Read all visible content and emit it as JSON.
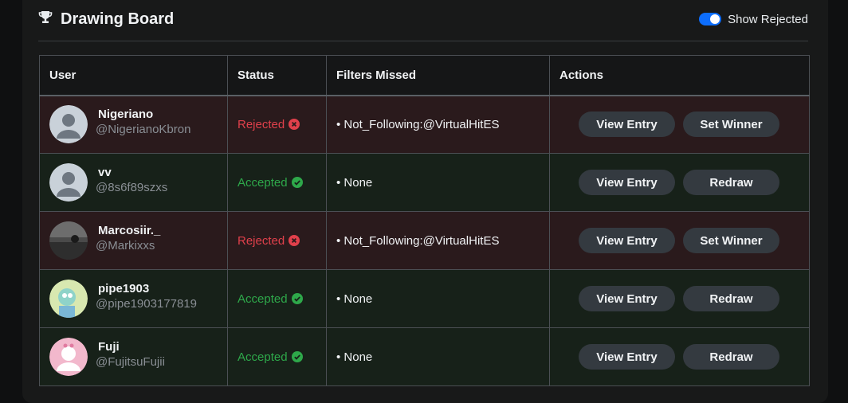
{
  "header": {
    "title": "Drawing Board",
    "icon": "trophy-icon",
    "toggle_label": "Show Rejected",
    "toggle_on": true,
    "accent_color": "#0d6efd"
  },
  "table": {
    "columns": [
      "User",
      "Status",
      "Filters Missed",
      "Actions"
    ],
    "rows": [
      {
        "name": "Nigeriano",
        "handle": "@NigerianoKbron",
        "avatar": "default-avatar",
        "status": "Rejected",
        "status_type": "rejected",
        "filter": "• Not_Following:@VirtualHitES",
        "view_label": "View Entry",
        "action_label": "Set Winner"
      },
      {
        "name": "vv",
        "handle": "@8s6f89szxs",
        "avatar": "default-avatar",
        "status": "Accepted",
        "status_type": "accepted",
        "filter": "• None",
        "view_label": "View Entry",
        "action_label": "Redraw"
      },
      {
        "name": "Marcosiir._",
        "handle": "@Markixxs",
        "avatar": "photo-avatar",
        "status": "Rejected",
        "status_type": "rejected",
        "filter": "• Not_Following:@VirtualHitES",
        "view_label": "View Entry",
        "action_label": "Set Winner"
      },
      {
        "name": "pipe1903",
        "handle": "@pipe1903177819",
        "avatar": "cartoon-avatar",
        "status": "Accepted",
        "status_type": "accepted",
        "filter": "• None",
        "view_label": "View Entry",
        "action_label": "Redraw"
      },
      {
        "name": "Fuji",
        "handle": "@FujitsuFujii",
        "avatar": "pink-avatar",
        "status": "Accepted",
        "status_type": "accepted",
        "filter": "• None",
        "view_label": "View Entry",
        "action_label": "Redraw"
      }
    ]
  },
  "colors": {
    "rejected": "#e0404b",
    "accepted": "#2ea84a",
    "rejected_row": "#2a1a1c",
    "accepted_row": "#172119"
  }
}
